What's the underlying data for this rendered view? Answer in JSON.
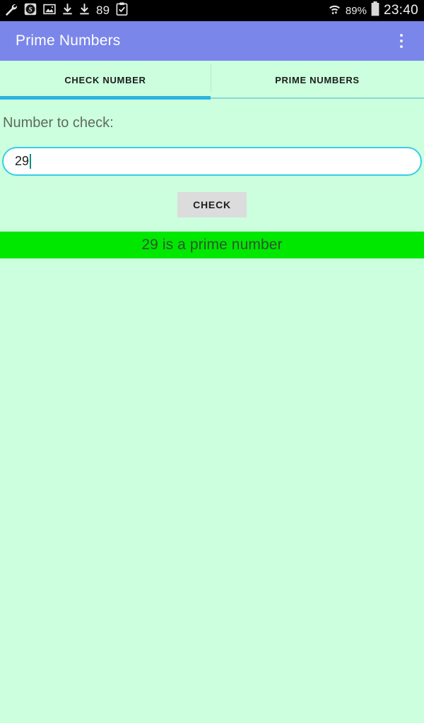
{
  "status_bar": {
    "left_icons": [
      {
        "name": "wrench-icon",
        "glyph": "wrench"
      },
      {
        "name": "s-badge-icon",
        "glyph": "S"
      },
      {
        "name": "photo-icon",
        "glyph": "photo"
      },
      {
        "name": "download-icon-1",
        "glyph": "download"
      },
      {
        "name": "download-icon-2",
        "glyph": "download"
      }
    ],
    "notification_count": "89",
    "clipboard_icon": "clipboard-check-icon",
    "wifi_icon": "wifi-icon",
    "battery_percent": "89%",
    "battery_icon": "battery-icon",
    "clock": "23:40"
  },
  "app_bar": {
    "title": "Prime Numbers",
    "overflow_menu": "more-options",
    "background": "#7a86ea",
    "title_color": "#ffffff"
  },
  "tabs": {
    "items": [
      {
        "label": "CHECK NUMBER",
        "selected": true
      },
      {
        "label": "PRIME NUMBERS",
        "selected": false
      }
    ],
    "indicator_color": "#2bb3e0"
  },
  "check_number_tab": {
    "field_label": "Number to check:",
    "input": {
      "value": "29",
      "placeholder": "",
      "border_color": "#37cde6"
    },
    "check_button_label": "CHECK",
    "result": {
      "text": "29 is a prime number",
      "background": "#00e800",
      "text_color": "#2a562f"
    }
  },
  "page": {
    "background": "#ccffdd"
  }
}
